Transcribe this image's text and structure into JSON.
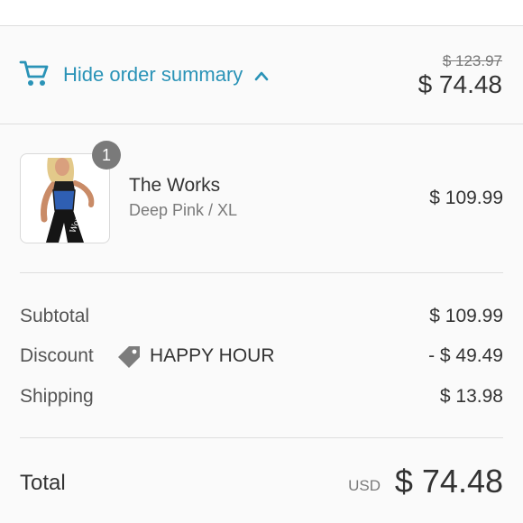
{
  "summary_toggle": {
    "label": "Hide order summary",
    "icon": "cart-icon",
    "chevron": "chevron-up-icon",
    "accent_color": "#2a93b7"
  },
  "header_prices": {
    "compare_at": "$ 123.97",
    "total": "$ 74.48"
  },
  "line_items": [
    {
      "name": "The Works",
      "variant": "Deep Pink / XL",
      "quantity": "1",
      "price": "$ 109.99"
    }
  ],
  "totals": {
    "subtotal_label": "Subtotal",
    "subtotal_value": "$ 109.99",
    "discount_label": "Discount",
    "discount_code": "HAPPY HOUR",
    "discount_icon": "tag-icon",
    "discount_value": "- $ 49.49",
    "shipping_label": "Shipping",
    "shipping_value": "$ 13.98",
    "total_label": "Total",
    "currency": "USD",
    "total_value": "$ 74.48"
  }
}
